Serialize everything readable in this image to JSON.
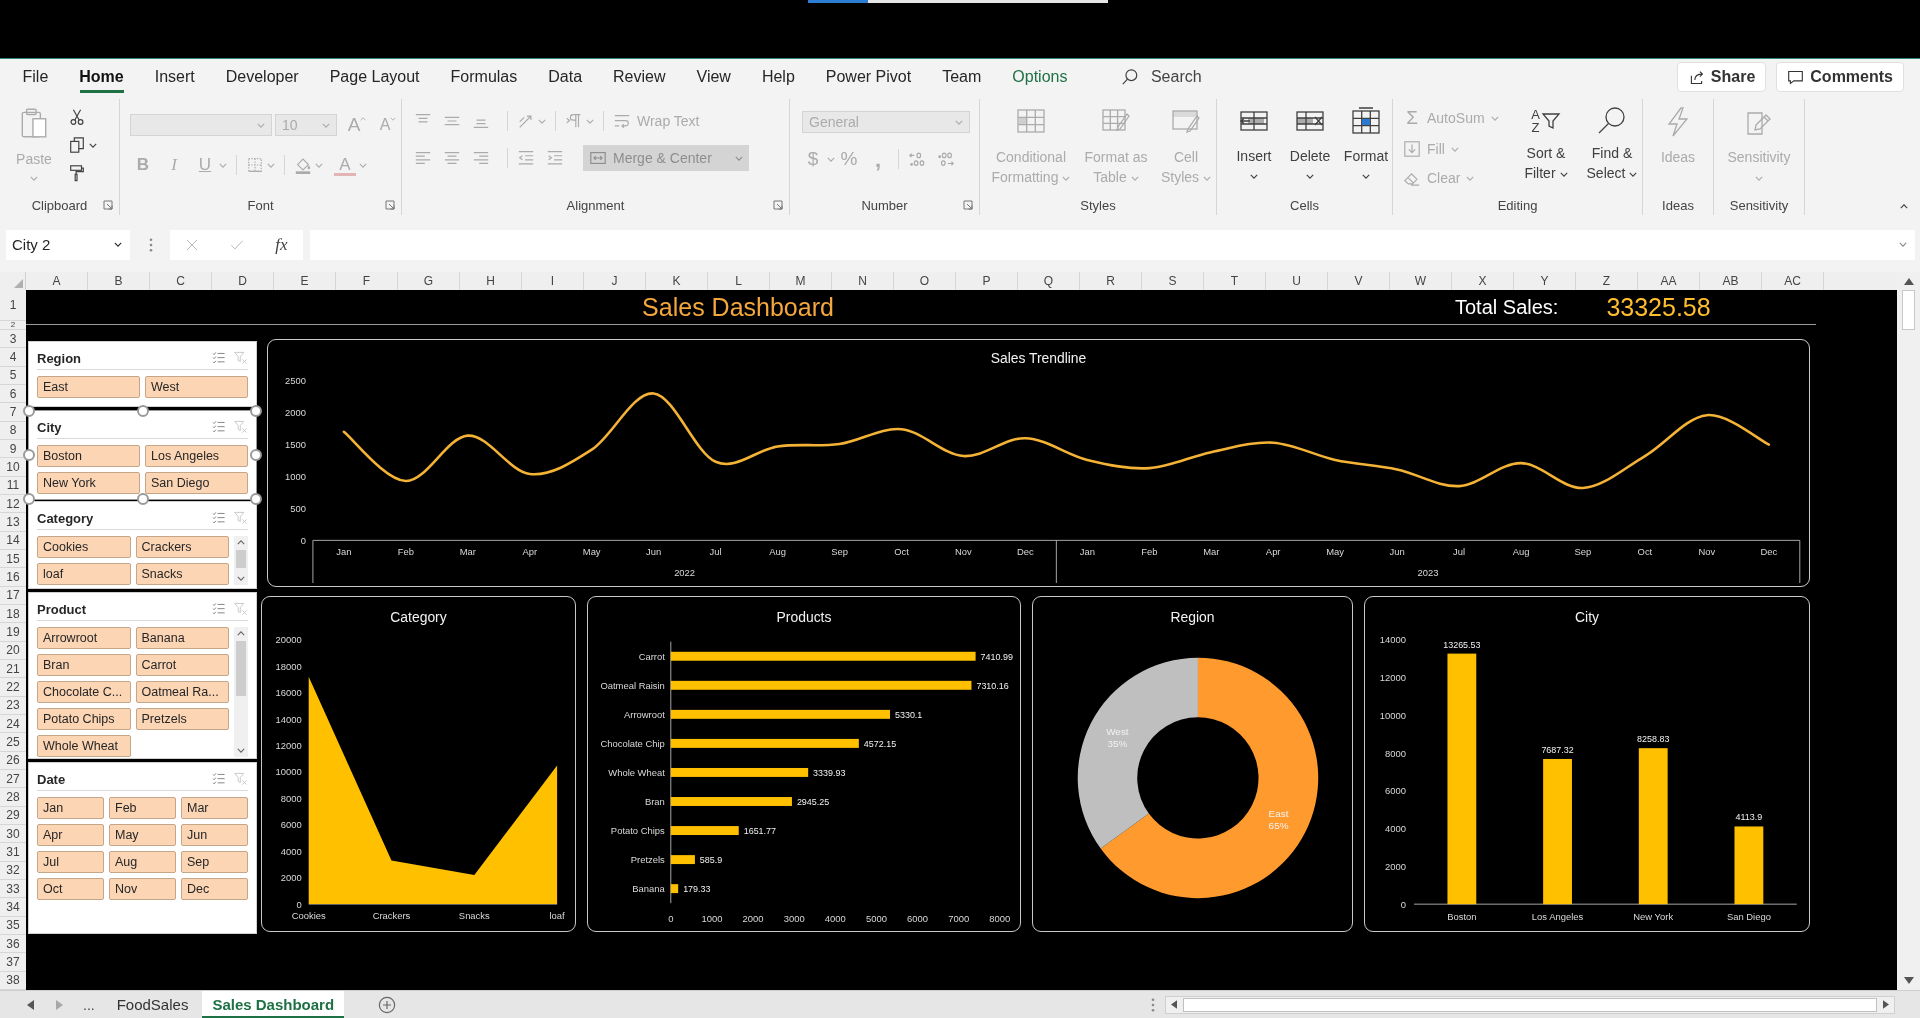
{
  "top_bar": {
    "progress": {
      "level": 0.2
    }
  },
  "ribbon": {
    "tabs": [
      {
        "label": "File",
        "selected": false,
        "contextual": false
      },
      {
        "label": "Home",
        "selected": true,
        "contextual": false
      },
      {
        "label": "Insert",
        "selected": false,
        "contextual": false
      },
      {
        "label": "Developer",
        "selected": false,
        "contextual": false
      },
      {
        "label": "Page Layout",
        "selected": false,
        "contextual": false
      },
      {
        "label": "Formulas",
        "selected": false,
        "contextual": false
      },
      {
        "label": "Data",
        "selected": false,
        "contextual": false
      },
      {
        "label": "Review",
        "selected": false,
        "contextual": false
      },
      {
        "label": "View",
        "selected": false,
        "contextual": false
      },
      {
        "label": "Help",
        "selected": false,
        "contextual": false
      },
      {
        "label": "Power Pivot",
        "selected": false,
        "contextual": false
      },
      {
        "label": "Team",
        "selected": false,
        "contextual": false
      },
      {
        "label": "Options",
        "selected": false,
        "contextual": true
      }
    ],
    "search": {
      "placeholder": "Search"
    },
    "share": "Share",
    "comments": "Comments",
    "groups": [
      {
        "label": "Clipboard",
        "launcher": true,
        "items": [
          {
            "label": "Paste",
            "disabled": true
          },
          {
            "disabled": false
          },
          {
            "disabled": false
          },
          {
            "disabled": false
          }
        ]
      },
      {
        "label": "Font",
        "launcher": true,
        "items": [
          {
            "disabled": true
          },
          {
            "value": "10",
            "disabled": true
          },
          {
            "glyph": "A",
            "disabled": true
          },
          {
            "glyph": "A",
            "disabled": true
          },
          {
            "glyph": "B",
            "disabled": true
          },
          {
            "glyph": "I",
            "disabled": true
          },
          {
            "glyph": "U",
            "disabled": true
          },
          {
            "disabled": true
          },
          {
            "disabled": true
          },
          {
            "glyph": "A",
            "disabled": true
          }
        ]
      },
      {
        "label": "Alignment",
        "launcher": true,
        "items": [
          {
            "disabled": true
          },
          {
            "disabled": true
          },
          {
            "disabled": true
          },
          {
            "disabled": true
          },
          {
            "disabled": true
          },
          {
            "label": "Wrap Text",
            "disabled": true
          },
          {
            "disabled": true
          },
          {
            "disabled": true
          },
          {
            "disabled": true
          },
          {
            "disabled": true
          },
          {
            "disabled": true
          },
          {
            "label": "Merge & Center",
            "disabled": true
          }
        ]
      },
      {
        "label": "Number",
        "launcher": true,
        "items": [
          {
            "value": "General",
            "disabled": true
          },
          {
            "glyph": "$",
            "disabled": true
          },
          {
            "glyph": "%",
            "disabled": true
          },
          {
            "glyph": ",",
            "disabled": true
          },
          {
            "disabled": true
          },
          {
            "disabled": true
          }
        ]
      },
      {
        "label": "Styles",
        "launcher": false,
        "items": [
          {
            "label": "Conditional Formatting",
            "disabled": true
          },
          {
            "label": "Format as Table",
            "disabled": true
          },
          {
            "label": "Cell Styles",
            "disabled": true
          }
        ]
      },
      {
        "label": "Cells",
        "launcher": false,
        "items": [
          {
            "label": "Insert",
            "disabled": false
          },
          {
            "label": "Delete",
            "disabled": false
          },
          {
            "label": "Format",
            "disabled": false
          }
        ]
      },
      {
        "label": "Editing",
        "launcher": false,
        "items": [
          {
            "glyph": "Σ",
            "label": "AutoSum",
            "disabled": true
          },
          {
            "label": "Fill",
            "disabled": true
          },
          {
            "label": "Clear",
            "disabled": true
          },
          {
            "glyphs": [
              "A",
              "Z"
            ],
            "label": "Sort & Filter",
            "disabled": false
          },
          {
            "label": "Find & Select",
            "disabled": false
          }
        ]
      },
      {
        "label": "Ideas",
        "launcher": false,
        "items": [
          {
            "label": "Ideas",
            "disabled": true
          }
        ]
      },
      {
        "label": "Sensitivity",
        "launcher": false,
        "items": [
          {
            "label": "Sensitivity",
            "disabled": true
          }
        ]
      }
    ]
  },
  "formula_bar": {
    "name_box": "City 2",
    "cancel": {
      "disabled": true
    },
    "enter": {
      "disabled": true
    },
    "insert_function": "fx"
  },
  "sheet": {
    "columns": [
      "A",
      "B",
      "C",
      "D",
      "E",
      "F",
      "G",
      "H",
      "I",
      "J",
      "K",
      "L",
      "M",
      "N",
      "O",
      "P",
      "Q",
      "R",
      "S",
      "T",
      "U",
      "V",
      "W",
      "X",
      "Y",
      "Z",
      "AA",
      "AB",
      "AC"
    ],
    "rows": [
      "1",
      "2",
      "3",
      "4",
      "5",
      "6",
      "7",
      "8",
      "9",
      "10",
      "11",
      "12",
      "13",
      "14",
      "15",
      "16",
      "17",
      "18",
      "19",
      "20",
      "21",
      "22",
      "23",
      "24",
      "25",
      "26",
      "27",
      "28",
      "29",
      "30",
      "31",
      "32",
      "33",
      "34",
      "35",
      "36",
      "37",
      "38"
    ]
  },
  "dashboard": {
    "title": "Sales Dashboard",
    "total_sales": {
      "label": "Total Sales:",
      "value": "33325.58"
    },
    "slicers": [
      {
        "title": "Region",
        "selected": false,
        "scrollbar": false,
        "clear_disabled": true,
        "items": [
          {
            "label": "East",
            "selected": true
          },
          {
            "label": "West",
            "selected": true
          }
        ]
      },
      {
        "title": "City",
        "selected": true,
        "scrollbar": false,
        "clear_disabled": true,
        "items": [
          {
            "label": "Boston",
            "selected": true
          },
          {
            "label": "Los Angeles",
            "selected": true
          },
          {
            "label": "New York",
            "selected": true
          },
          {
            "label": "San Diego",
            "selected": true
          }
        ]
      },
      {
        "title": "Category",
        "selected": false,
        "scrollbar": true,
        "clear_disabled": true,
        "items": [
          {
            "label": "Cookies",
            "selected": true
          },
          {
            "label": "Crackers",
            "selected": true
          },
          {
            "label": "loaf",
            "selected": true
          },
          {
            "label": "Snacks",
            "selected": true
          }
        ]
      },
      {
        "title": "Product",
        "selected": false,
        "scrollbar": true,
        "clear_disabled": true,
        "items": [
          {
            "label": "Arrowroot",
            "selected": true
          },
          {
            "label": "Banana",
            "selected": true
          },
          {
            "label": "Bran",
            "selected": true
          },
          {
            "label": "Carrot",
            "selected": true
          },
          {
            "label": "Chocolate C...",
            "selected": true
          },
          {
            "label": "Oatmeal Ra...",
            "selected": true
          },
          {
            "label": "Potato Chips",
            "selected": true
          },
          {
            "label": "Pretzels",
            "selected": true
          },
          {
            "label": "Whole Wheat",
            "selected": true
          }
        ]
      },
      {
        "title": "Date",
        "selected": false,
        "scrollbar": false,
        "clear_disabled": true,
        "items": [
          {
            "label": "Jan",
            "selected": true
          },
          {
            "label": "Feb",
            "selected": true
          },
          {
            "label": "Mar",
            "selected": true
          },
          {
            "label": "Apr",
            "selected": true
          },
          {
            "label": "May",
            "selected": true
          },
          {
            "label": "Jun",
            "selected": true
          },
          {
            "label": "Jul",
            "selected": true
          },
          {
            "label": "Aug",
            "selected": true
          },
          {
            "label": "Sep",
            "selected": true
          },
          {
            "label": "Oct",
            "selected": true
          },
          {
            "label": "Nov",
            "selected": true
          },
          {
            "label": "Dec",
            "selected": true
          }
        ]
      }
    ],
    "charts": [
      {
        "chart_data": {
          "type": "line",
          "title": "Sales Trendline",
          "categories": [
            "Jan",
            "Feb",
            "Mar",
            "Apr",
            "May",
            "Jun",
            "Jul",
            "Aug",
            "Sep",
            "Oct",
            "Nov",
            "Dec",
            "Jan",
            "Feb",
            "Mar",
            "Apr",
            "May",
            "Jun",
            "Jul",
            "Aug",
            "Sep",
            "Oct",
            "Nov",
            "Dec"
          ],
          "annotations": [
            "2022",
            "2023"
          ],
          "values": [
            1700,
            930,
            1640,
            1040,
            1420,
            2300,
            1230,
            1470,
            1510,
            1740,
            1320,
            1600,
            1260,
            1130,
            1380,
            1530,
            1260,
            1110,
            850,
            1210,
            820,
            1320,
            1960,
            1500
          ],
          "color": "#f5b335",
          "ylim": [
            0,
            2500
          ],
          "yticks": [
            0,
            500,
            1000,
            1500,
            2000,
            2500
          ]
        }
      },
      {
        "chart_data": {
          "type": "area",
          "title": "Category",
          "categories": [
            "Cookies",
            "Crackers",
            "Snacks",
            "loaf"
          ],
          "values": [
            17200,
            3300,
            2200,
            10500
          ],
          "color": "#ffc000",
          "ylim": [
            0,
            20000
          ],
          "yticks": [
            0,
            2000,
            4000,
            6000,
            8000,
            10000,
            12000,
            14000,
            16000,
            18000,
            20000
          ]
        }
      },
      {
        "chart_data": {
          "type": "bar",
          "orientation": "horizontal",
          "title": "Products",
          "categories": [
            "Carrot",
            "Oatmeal Raisin",
            "Arrowroot",
            "Chocolate Chip",
            "Whole Wheat",
            "Bran",
            "Potato Chips",
            "Pretzels",
            "Banana"
          ],
          "values": [
            7410.99,
            7310.16,
            5330.1,
            4572.15,
            3339.93,
            2945.25,
            1651.77,
            585.9,
            179.33
          ],
          "color": "#ffc000",
          "xlim": [
            0,
            8000
          ],
          "xticks": [
            0,
            1000,
            2000,
            3000,
            4000,
            5000,
            6000,
            7000,
            8000
          ],
          "data_labels": true
        }
      },
      {
        "chart_data": {
          "type": "donut",
          "title": "Region",
          "categories": [
            "East",
            "West"
          ],
          "values": [
            65,
            35
          ],
          "colors": [
            "#ff9a2e",
            "#bfbfbf"
          ],
          "value_labels": [
            "65%",
            "35%"
          ]
        }
      },
      {
        "chart_data": {
          "type": "bar",
          "title": "City",
          "categories": [
            "Boston",
            "Los Angeles",
            "New York",
            "San Diego"
          ],
          "values": [
            13265.53,
            7687.32,
            8258.83,
            4113.9
          ],
          "color": "#ffc000",
          "ylim": [
            0,
            14000
          ],
          "yticks": [
            0,
            2000,
            4000,
            6000,
            8000,
            10000,
            12000,
            14000
          ],
          "data_labels": true
        }
      }
    ]
  },
  "sheet_tabs": {
    "overflow": "...",
    "tabs": [
      {
        "label": "FoodSales",
        "selected": false
      },
      {
        "label": "Sales Dashboard",
        "selected": true
      }
    ]
  }
}
